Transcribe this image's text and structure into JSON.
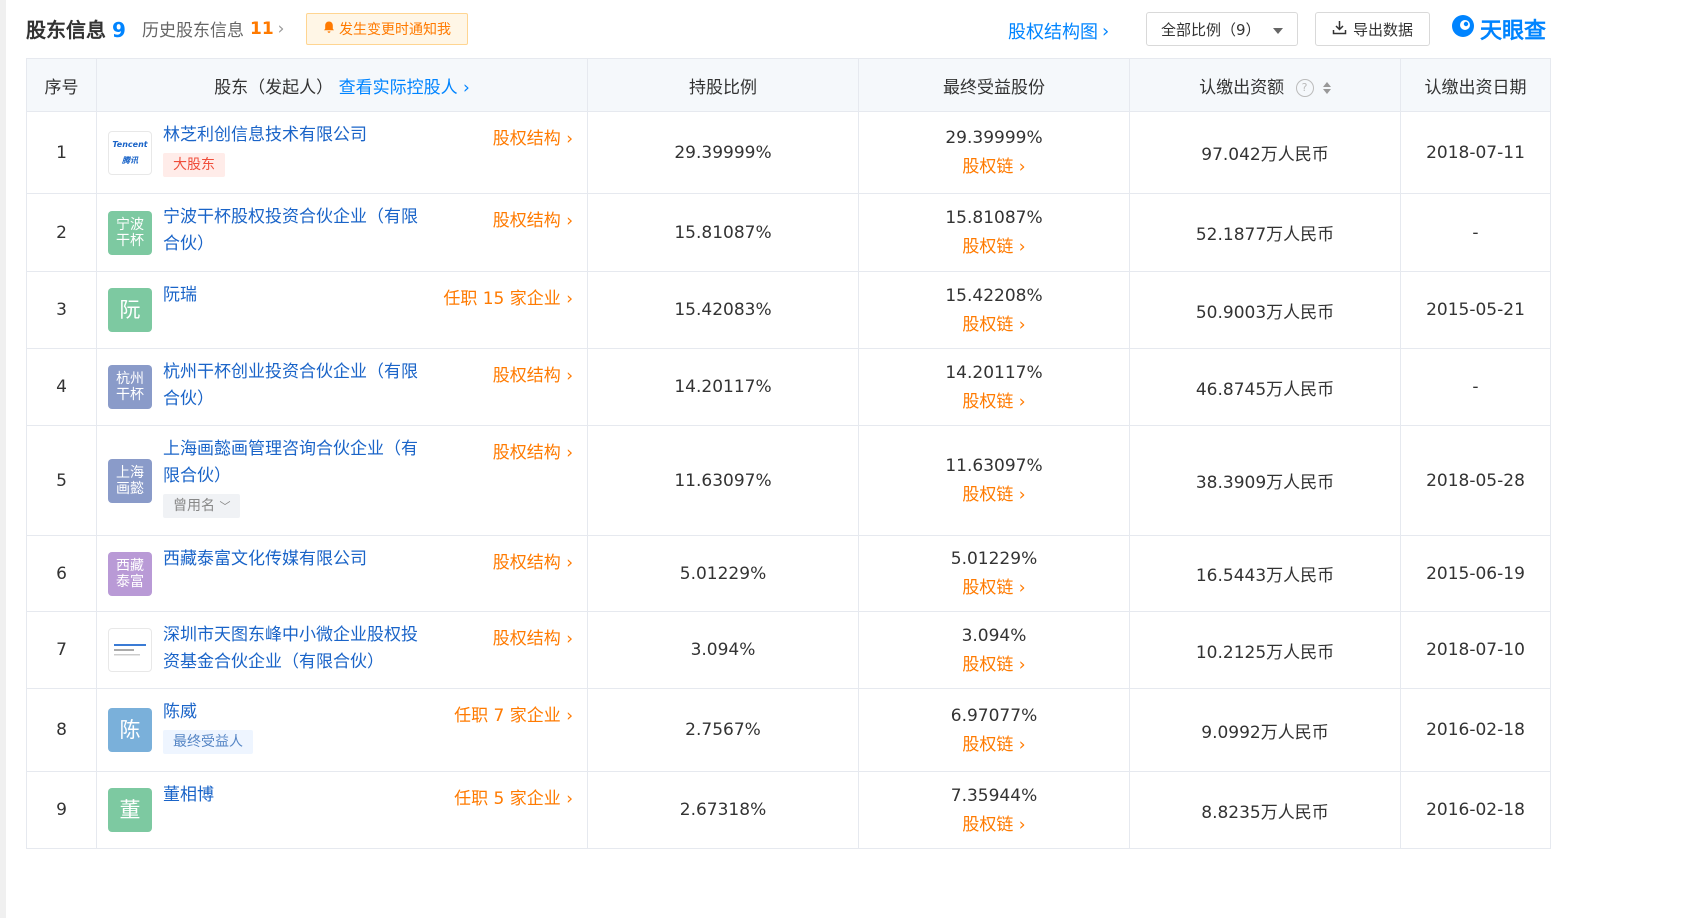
{
  "header": {
    "title": "股东信息",
    "count": "9",
    "history_label": "历史股东信息",
    "history_count": "11",
    "notify_label": "发生变更时通知我",
    "equity_chart_label": "股权结构图",
    "ratio_select": "全部比例（9）",
    "export_label": "导出数据",
    "brand": "天眼查"
  },
  "columns": {
    "index": "序号",
    "shareholder": "股东（发起人）",
    "controller_link": "查看实际控股人",
    "holding_ratio": "持股比例",
    "final_benefit": "最终受益股份",
    "subscribed": "认缴出资额",
    "subscribed_date": "认缴出资日期"
  },
  "rows": [
    {
      "idx": "1",
      "avatar": "Tencent 腾讯",
      "avatar_type": "logo-tencent",
      "name": "林芝利创信息技术有限公司",
      "link": "股权结构",
      "tag": "大股东",
      "tag_type": "red",
      "ratio": "29.39999%",
      "benefit": "29.39999%",
      "chain": "股权链",
      "amount": "97.042万人民币",
      "date": "2018-07-11"
    },
    {
      "idx": "2",
      "avatar": "宁波干杯",
      "avatar_color": "#7dc9a1",
      "name": "宁波干杯股权投资合伙企业（有限合伙）",
      "link": "股权结构",
      "tag": "",
      "ratio": "15.81087%",
      "benefit": "15.81087%",
      "chain": "股权链",
      "amount": "52.1877万人民币",
      "date": "-"
    },
    {
      "idx": "3",
      "avatar": "阮",
      "avatar_color": "#7dc9a1",
      "avatar_big": true,
      "name": "阮瑞",
      "link": "任职 15 家企业",
      "tag": "",
      "ratio": "15.42083%",
      "benefit": "15.42208%",
      "chain": "股权链",
      "amount": "50.9003万人民币",
      "date": "2015-05-21"
    },
    {
      "idx": "4",
      "avatar": "杭州干杯",
      "avatar_color": "#8a9bc9",
      "name": "杭州干杯创业投资合伙企业（有限合伙）",
      "link": "股权结构",
      "tag": "",
      "ratio": "14.20117%",
      "benefit": "14.20117%",
      "chain": "股权链",
      "amount": "46.8745万人民币",
      "date": "-"
    },
    {
      "idx": "5",
      "avatar": "上海画懿",
      "avatar_color": "#8a9bc9",
      "name": "上海画懿画管理咨询合伙企业（有限合伙）",
      "link": "股权结构",
      "tag": "曾用名",
      "tag_type": "gray",
      "ratio": "11.63097%",
      "benefit": "11.63097%",
      "chain": "股权链",
      "amount": "38.3909万人民币",
      "date": "2018-05-28"
    },
    {
      "idx": "6",
      "avatar": "西藏泰富",
      "avatar_color": "#b99ad6",
      "name": "西藏泰富文化传媒有限公司",
      "link": "股权结构",
      "tag": "",
      "ratio": "5.01229%",
      "benefit": "5.01229%",
      "chain": "股权链",
      "amount": "16.5443万人民币",
      "date": "2015-06-19"
    },
    {
      "idx": "7",
      "avatar": "",
      "avatar_type": "logo-tt",
      "name": "深圳市天图东峰中小微企业股权投资基金合伙企业（有限合伙）",
      "link": "股权结构",
      "tag": "",
      "ratio": "3.094%",
      "benefit": "3.094%",
      "chain": "股权链",
      "amount": "10.2125万人民币",
      "date": "2018-07-10"
    },
    {
      "idx": "8",
      "avatar": "陈",
      "avatar_color": "#7ab0da",
      "avatar_big": true,
      "name": "陈威",
      "link": "任职 7 家企业",
      "tag": "最终受益人",
      "tag_type": "blue",
      "ratio": "2.7567%",
      "benefit": "6.97077%",
      "chain": "股权链",
      "amount": "9.0992万人民币",
      "date": "2016-02-18"
    },
    {
      "idx": "9",
      "avatar": "董",
      "avatar_color": "#7dc9a1",
      "avatar_big": true,
      "name": "董相博",
      "link": "任职 5 家企业",
      "tag": "",
      "ratio": "2.67318%",
      "benefit": "7.35944%",
      "chain": "股权链",
      "amount": "8.8235万人民币",
      "date": "2016-02-18"
    }
  ]
}
